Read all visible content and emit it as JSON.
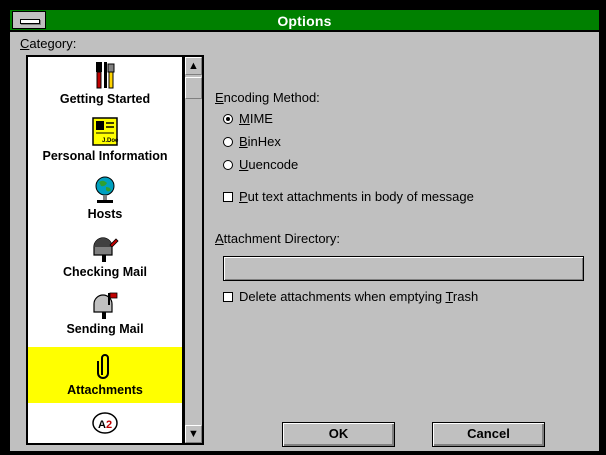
{
  "window": {
    "title": "Options"
  },
  "category": {
    "label": "Category:",
    "items": [
      {
        "label": "Getting Started",
        "icon": "tools-icon",
        "selected": false
      },
      {
        "label": "Personal Information",
        "icon": "id-card-icon",
        "selected": false
      },
      {
        "label": "Hosts",
        "icon": "globe-icon",
        "selected": false
      },
      {
        "label": "Checking Mail",
        "icon": "mailbox-icon",
        "selected": false
      },
      {
        "label": "Sending Mail",
        "icon": "mailbox-flag-icon",
        "selected": false
      },
      {
        "label": "Attachments",
        "icon": "paperclip-icon",
        "selected": true
      }
    ]
  },
  "encoding": {
    "label": "Encoding Method:",
    "options": [
      {
        "label": "MIME",
        "selected": true
      },
      {
        "label": "BinHex",
        "selected": false
      },
      {
        "label": "Uuencode",
        "selected": false
      }
    ]
  },
  "put_text_label": "Put text attachments in body of message",
  "attachment_dir": {
    "label": "Attachment Directory:",
    "value": ""
  },
  "delete_label": "Delete attachments when emptying Trash",
  "buttons": {
    "ok": "OK",
    "cancel": "Cancel"
  },
  "colors": {
    "titlebar": "#008000",
    "selection": "#ffff00",
    "face": "#c0c0c0"
  }
}
